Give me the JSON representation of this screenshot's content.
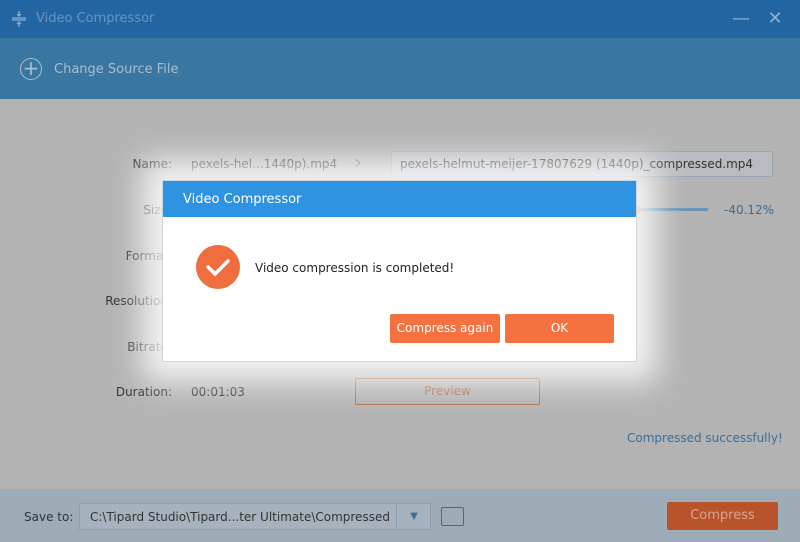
{
  "window": {
    "title": "Video Compressor",
    "minimize": "—",
    "close": "✕"
  },
  "toolbar": {
    "change_source": "Change Source File"
  },
  "form": {
    "name_label": "Name:",
    "name_value": "pexels-hel...1440p).mp4",
    "output_name": "pexels-helmut-meijer-17807629 (1440p)_compressed.mp4",
    "size_label": "Size:",
    "size_percent": "-40.12%",
    "format_label": "Format:",
    "resolution_label": "Resolution:",
    "bitrate_label": "Bitrate:",
    "duration_label": "Duration:",
    "duration_value": "00:01:03",
    "preview": "Preview",
    "status": "Compressed successfully!"
  },
  "footer": {
    "save_to_label": "Save to:",
    "save_path": "C:\\Tipard Studio\\Tipard...ter Ultimate\\Compressed",
    "compress": "Compress"
  },
  "dialog": {
    "title": "Video Compressor",
    "message": "Video compression is completed!",
    "compress_again": "Compress again",
    "ok": "OK"
  },
  "colors": {
    "accent": "#f5713f",
    "dialog_header": "#2e93e0"
  }
}
